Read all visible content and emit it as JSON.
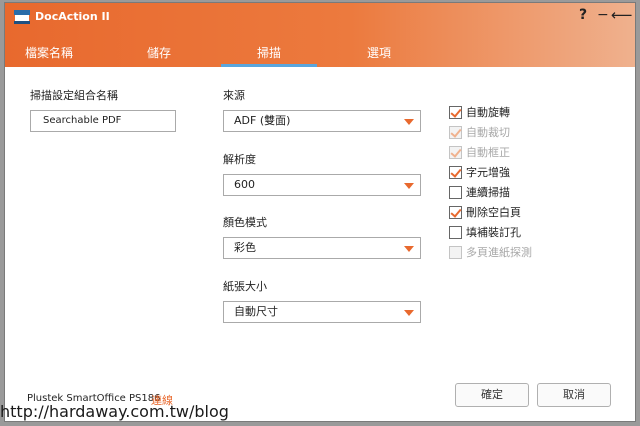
{
  "app": {
    "title": "DocAction II"
  },
  "titlebar": {
    "help": "?",
    "minimize": "−",
    "back": "⟵"
  },
  "tabs": [
    {
      "label": "檔案名稱"
    },
    {
      "label": "儲存"
    },
    {
      "label": "掃描",
      "active": true
    },
    {
      "label": "選項"
    }
  ],
  "profile": {
    "label": "掃描設定組合名稱",
    "value": "Searchable PDF"
  },
  "source": {
    "label": "來源",
    "value": "ADF (雙面)"
  },
  "resolution": {
    "label": "解析度",
    "value": "600"
  },
  "color_mode": {
    "label": "顏色模式",
    "value": "彩色"
  },
  "paper_size": {
    "label": "紙張大小",
    "value": "自動尺寸"
  },
  "options": [
    {
      "label": "自動旋轉",
      "checked": true,
      "enabled": true
    },
    {
      "label": "自動裁切",
      "checked": true,
      "enabled": false
    },
    {
      "label": "自動框正",
      "checked": true,
      "enabled": false
    },
    {
      "label": "字元增強",
      "checked": true,
      "enabled": true
    },
    {
      "label": "連續掃描",
      "checked": false,
      "enabled": true
    },
    {
      "label": "刪除空白頁",
      "checked": true,
      "enabled": true
    },
    {
      "label": "填補裝訂孔",
      "checked": false,
      "enabled": true
    },
    {
      "label": "多頁進紙探測",
      "checked": false,
      "enabled": false
    }
  ],
  "footer": {
    "device": "Plustek SmartOffice PS186",
    "status": "連線",
    "ok": "確定",
    "cancel": "取消"
  },
  "watermark": "http://hardaway.com.tw/blog",
  "colors": {
    "accent": "#e8692e",
    "tab_underline": "#5aa6dd"
  }
}
